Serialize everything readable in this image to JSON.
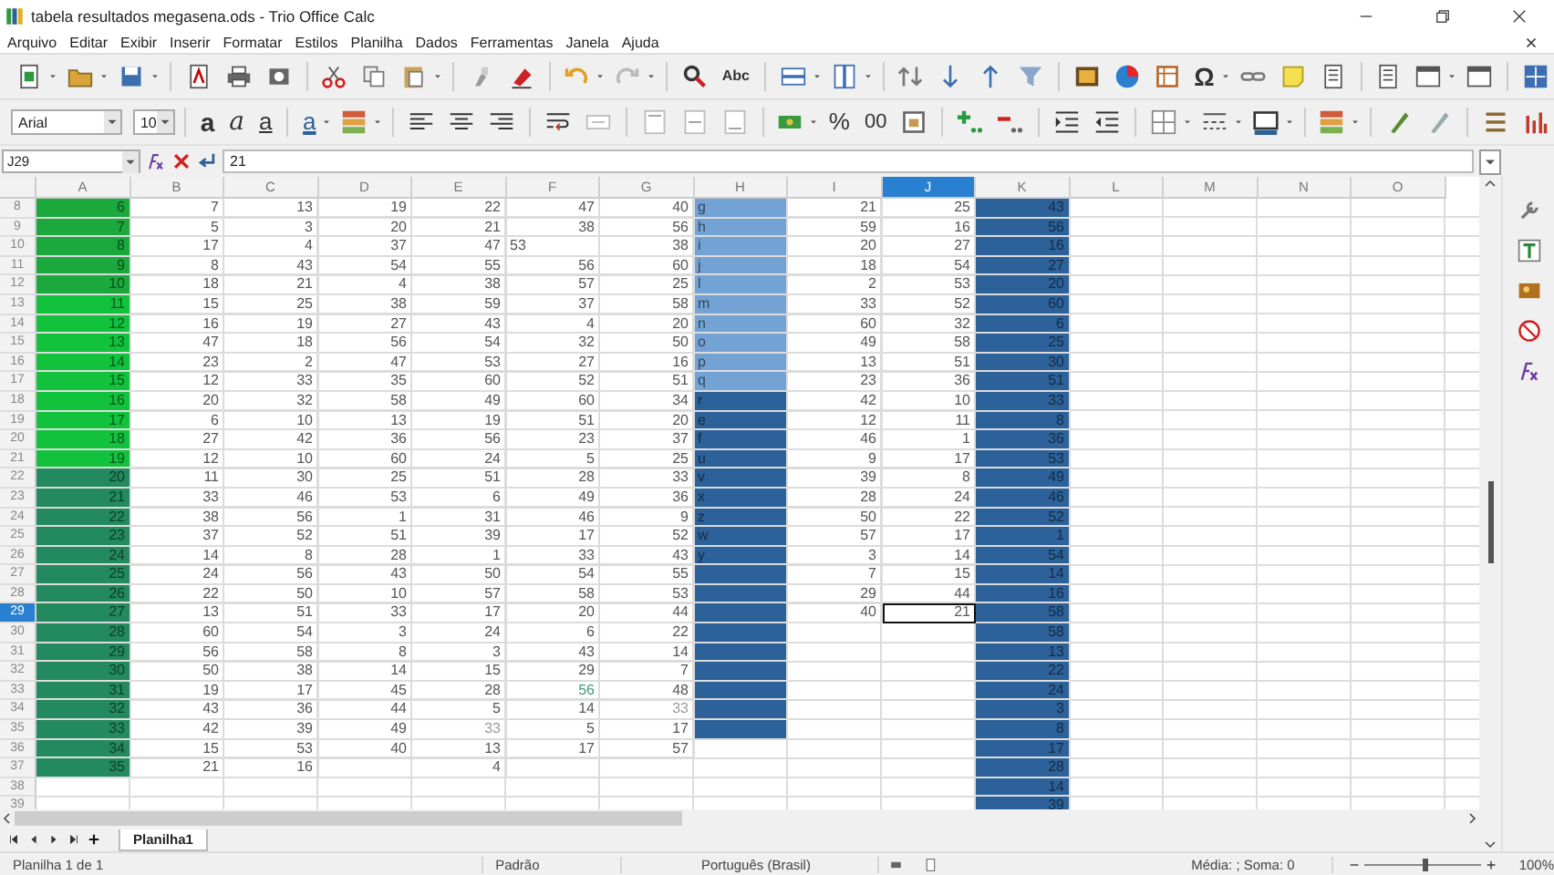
{
  "window": {
    "title": "tabela resultados megasena.ods - Trio Office Calc"
  },
  "menu": [
    "Arquivo",
    "Editar",
    "Exibir",
    "Inserir",
    "Formatar",
    "Estilos",
    "Planilha",
    "Dados",
    "Ferramentas",
    "Janela",
    "Ajuda"
  ],
  "toolbar_glyphs": {
    "spelling": "Abc",
    "special_character": "Ω",
    "bold": "a",
    "italic": "a",
    "underline": "a",
    "font_color": "a",
    "percent": "%",
    "decimal": "00"
  },
  "font": {
    "name": "Arial",
    "size": "10"
  },
  "formula_bar": {
    "cell": "J29",
    "value": "21"
  },
  "columns": [
    {
      "label": "A",
      "selected": false
    },
    {
      "label": "B",
      "selected": false
    },
    {
      "label": "C",
      "selected": false
    },
    {
      "label": "D",
      "selected": false
    },
    {
      "label": "E",
      "selected": false
    },
    {
      "label": "F",
      "selected": false
    },
    {
      "label": "G",
      "selected": false
    },
    {
      "label": "H",
      "selected": false
    },
    {
      "label": "I",
      "selected": false
    },
    {
      "label": "J",
      "selected": true
    },
    {
      "label": "K",
      "selected": false
    },
    {
      "label": "L",
      "selected": false
    },
    {
      "label": "M",
      "selected": false
    },
    {
      "label": "N",
      "selected": false
    },
    {
      "label": "O",
      "selected": false
    }
  ],
  "rows": [
    {
      "number": "8",
      "selected": false,
      "cells": [
        {
          "text": "6",
          "color": "#1ba83c"
        },
        "7",
        "13",
        "19",
        "22",
        "47",
        "40",
        {
          "text": "g",
          "kind": "text",
          "color": "#73a2d4"
        },
        "21",
        "25",
        {
          "text": "43",
          "color": "#2d6199"
        }
      ]
    },
    {
      "number": "9",
      "selected": false,
      "cells": [
        {
          "text": "7",
          "color": "#1ba83c"
        },
        "5",
        "3",
        "20",
        "21",
        "38",
        "56",
        {
          "text": "h",
          "kind": "text",
          "color": "#73a2d4"
        },
        "59",
        "16",
        {
          "text": "56",
          "color": "#2d6199"
        }
      ]
    },
    {
      "number": "10",
      "selected": false,
      "cells": [
        {
          "text": "8",
          "color": "#1ba83c"
        },
        "17",
        "4",
        "37",
        "47",
        {
          "text": "53",
          "kind": "text"
        },
        "38",
        {
          "text": "i",
          "kind": "text",
          "color": "#73a2d4"
        },
        "20",
        "27",
        {
          "text": "16",
          "color": "#2d6199"
        }
      ]
    },
    {
      "number": "11",
      "selected": false,
      "cells": [
        {
          "text": "9",
          "color": "#1ba83c"
        },
        "8",
        "43",
        "54",
        "55",
        "56",
        "60",
        {
          "text": "j",
          "kind": "text",
          "color": "#73a2d4"
        },
        "18",
        "54",
        {
          "text": "27",
          "color": "#2d6199"
        }
      ]
    },
    {
      "number": "12",
      "selected": false,
      "cells": [
        {
          "text": "10",
          "color": "#1ba83c"
        },
        "18",
        "21",
        "4",
        "38",
        "57",
        "25",
        {
          "text": "l",
          "kind": "text",
          "color": "#73a2d4"
        },
        "2",
        "53",
        {
          "text": "20",
          "color": "#2d6199"
        }
      ]
    },
    {
      "number": "13",
      "selected": false,
      "cells": [
        {
          "text": "11",
          "color": "#12c23d"
        },
        "15",
        "25",
        "38",
        "59",
        "37",
        "58",
        {
          "text": "m",
          "kind": "text",
          "color": "#73a2d4"
        },
        "33",
        "52",
        {
          "text": "60",
          "color": "#2d6199"
        }
      ]
    },
    {
      "number": "14",
      "selected": false,
      "cells": [
        {
          "text": "12",
          "color": "#12c23d"
        },
        "16",
        "19",
        "27",
        "43",
        "4",
        "20",
        {
          "text": "n",
          "kind": "text",
          "color": "#73a2d4"
        },
        "60",
        "32",
        {
          "text": "6",
          "color": "#2d6199"
        }
      ]
    },
    {
      "number": "15",
      "selected": false,
      "cells": [
        {
          "text": "13",
          "color": "#12c23d"
        },
        "47",
        "18",
        "56",
        "54",
        "32",
        "50",
        {
          "text": "o",
          "kind": "text",
          "color": "#73a2d4"
        },
        "49",
        "58",
        {
          "text": "25",
          "color": "#2d6199"
        }
      ]
    },
    {
      "number": "16",
      "selected": false,
      "cells": [
        {
          "text": "14",
          "color": "#12c23d"
        },
        "23",
        "2",
        "47",
        "53",
        "27",
        "16",
        {
          "text": "p",
          "kind": "text",
          "color": "#73a2d4"
        },
        "13",
        "51",
        {
          "text": "30",
          "color": "#2d6199"
        }
      ]
    },
    {
      "number": "17",
      "selected": false,
      "cells": [
        {
          "text": "15",
          "color": "#12c23d"
        },
        "12",
        "33",
        "35",
        "60",
        "52",
        "51",
        {
          "text": "q",
          "kind": "text",
          "color": "#73a2d4"
        },
        "23",
        "36",
        {
          "text": "51",
          "color": "#2d6199"
        }
      ]
    },
    {
      "number": "18",
      "selected": false,
      "cells": [
        {
          "text": "16",
          "color": "#12c23d"
        },
        "20",
        "32",
        "58",
        "49",
        "60",
        "34",
        {
          "text": "r",
          "kind": "text",
          "color": "#2d6199"
        },
        "42",
        "10",
        {
          "text": "33",
          "color": "#2d6199"
        }
      ]
    },
    {
      "number": "19",
      "selected": false,
      "cells": [
        {
          "text": "17",
          "color": "#12c23d"
        },
        "6",
        "10",
        "13",
        "19",
        "51",
        "20",
        {
          "text": "e",
          "kind": "text",
          "color": "#2d6199"
        },
        "12",
        "11",
        {
          "text": "8",
          "color": "#2d6199"
        }
      ]
    },
    {
      "number": "20",
      "selected": false,
      "cells": [
        {
          "text": "18",
          "color": "#12c23d"
        },
        "27",
        "42",
        "36",
        "56",
        "23",
        "37",
        {
          "text": "f",
          "kind": "text",
          "color": "#2d6199"
        },
        "46",
        "1",
        {
          "text": "36",
          "color": "#2d6199"
        }
      ]
    },
    {
      "number": "21",
      "selected": false,
      "cells": [
        {
          "text": "19",
          "color": "#12c23d"
        },
        "12",
        "10",
        "60",
        "24",
        "5",
        "25",
        {
          "text": "u",
          "kind": "text",
          "color": "#2d6199"
        },
        "9",
        "17",
        {
          "text": "53",
          "color": "#2d6199"
        }
      ]
    },
    {
      "number": "22",
      "selected": false,
      "cells": [
        {
          "text": "20",
          "color": "#23895e"
        },
        "11",
        "30",
        "25",
        "51",
        "28",
        "33",
        {
          "text": "v",
          "kind": "text",
          "color": "#2d6199"
        },
        "39",
        "8",
        {
          "text": "49",
          "color": "#2d6199"
        }
      ]
    },
    {
      "number": "23",
      "selected": false,
      "cells": [
        {
          "text": "21",
          "color": "#23895e"
        },
        "33",
        "46",
        "53",
        "6",
        "49",
        "36",
        {
          "text": "x",
          "kind": "text",
          "color": "#2d6199"
        },
        "28",
        "24",
        {
          "text": "46",
          "color": "#2d6199"
        }
      ]
    },
    {
      "number": "24",
      "selected": false,
      "cells": [
        {
          "text": "22",
          "color": "#23895e"
        },
        "38",
        "56",
        "1",
        "31",
        "46",
        "9",
        {
          "text": "z",
          "kind": "text",
          "color": "#2d6199"
        },
        "50",
        "22",
        {
          "text": "52",
          "color": "#2d6199"
        }
      ]
    },
    {
      "number": "25",
      "selected": false,
      "cells": [
        {
          "text": "23",
          "color": "#23895e"
        },
        "37",
        "52",
        "51",
        "39",
        "17",
        "52",
        {
          "text": "w",
          "kind": "text",
          "color": "#2d6199"
        },
        "57",
        "17",
        {
          "text": "1",
          "color": "#2d6199"
        }
      ]
    },
    {
      "number": "26",
      "selected": false,
      "cells": [
        {
          "text": "24",
          "color": "#23895e"
        },
        "14",
        "8",
        "28",
        "1",
        "33",
        "43",
        {
          "text": "y",
          "kind": "text",
          "color": "#2d6199"
        },
        "3",
        "14",
        {
          "text": "54",
          "color": "#2d6199"
        }
      ]
    },
    {
      "number": "27",
      "selected": false,
      "cells": [
        {
          "text": "25",
          "color": "#23895e"
        },
        "24",
        "56",
        "43",
        "50",
        "54",
        "55",
        {
          "text": "",
          "color": "#2d6199"
        },
        "7",
        "15",
        {
          "text": "14",
          "color": "#2d6199"
        }
      ]
    },
    {
      "number": "28",
      "selected": false,
      "cells": [
        {
          "text": "26",
          "color": "#23895e"
        },
        "22",
        "50",
        "10",
        "57",
        "58",
        "53",
        {
          "text": "",
          "color": "#2d6199"
        },
        "29",
        "44",
        {
          "text": "16",
          "color": "#2d6199"
        }
      ]
    },
    {
      "number": "29",
      "selected": true,
      "cells": [
        {
          "text": "27",
          "color": "#23895e"
        },
        "13",
        "51",
        "33",
        "17",
        "20",
        "44",
        {
          "text": "",
          "color": "#2d6199"
        },
        "40",
        "21",
        {
          "text": "58",
          "color": "#2d6199"
        }
      ]
    },
    {
      "number": "30",
      "selected": false,
      "cells": [
        {
          "text": "28",
          "color": "#23895e"
        },
        "60",
        "54",
        "3",
        "24",
        "6",
        "22",
        {
          "text": "",
          "color": "#2d6199"
        },
        "",
        "",
        {
          "text": "58",
          "color": "#2d6199"
        }
      ]
    },
    {
      "number": "31",
      "selected": false,
      "cells": [
        {
          "text": "29",
          "color": "#23895e"
        },
        "56",
        "58",
        "8",
        "3",
        "43",
        "14",
        {
          "text": "",
          "color": "#2d6199"
        },
        "",
        "",
        {
          "text": "13",
          "color": "#2d6199"
        }
      ]
    },
    {
      "number": "32",
      "selected": false,
      "cells": [
        {
          "text": "30",
          "color": "#23895e"
        },
        "50",
        "38",
        "14",
        "15",
        "29",
        "7",
        {
          "text": "",
          "color": "#2d6199"
        },
        "",
        "",
        {
          "text": "22",
          "color": "#2d6199"
        }
      ]
    },
    {
      "number": "33",
      "selected": false,
      "cells": [
        {
          "text": "31",
          "color": "#23895e"
        },
        "19",
        "17",
        "45",
        "28",
        {
          "text": "56",
          "kind": "highlighted"
        },
        "48",
        {
          "text": "",
          "color": "#2d6199"
        },
        "",
        "",
        {
          "text": "24",
          "color": "#2d6199"
        }
      ]
    },
    {
      "number": "34",
      "selected": false,
      "cells": [
        {
          "text": "32",
          "color": "#23895e"
        },
        "43",
        "36",
        "44",
        "5",
        "14",
        {
          "text": "33",
          "kind": "faded"
        },
        {
          "text": "",
          "color": "#2d6199"
        },
        "",
        "",
        {
          "text": "3",
          "color": "#2d6199"
        }
      ]
    },
    {
      "number": "35",
      "selected": false,
      "cells": [
        {
          "text": "33",
          "color": "#23895e"
        },
        "42",
        "39",
        "49",
        {
          "text": "33",
          "kind": "faded"
        },
        "5",
        "17",
        {
          "text": "",
          "color": "#2d6199"
        },
        "",
        "",
        {
          "text": "8",
          "color": "#2d6199"
        }
      ]
    },
    {
      "number": "36",
      "selected": false,
      "cells": [
        {
          "text": "34",
          "color": "#23895e"
        },
        "15",
        "53",
        "40",
        "13",
        "17",
        "57",
        "",
        "",
        "",
        {
          "text": "17",
          "color": "#2d6199"
        }
      ]
    },
    {
      "number": "37",
      "selected": false,
      "cells": [
        {
          "text": "35",
          "color": "#23895e"
        },
        "21",
        "16",
        "",
        "4",
        "",
        "",
        "",
        "",
        "",
        {
          "text": "28",
          "color": "#2d6199"
        }
      ]
    },
    {
      "number": "38",
      "selected": false,
      "cells": [
        "",
        "",
        "",
        "",
        "",
        "",
        "",
        "",
        "",
        "",
        {
          "text": "14",
          "color": "#2d6199"
        }
      ]
    },
    {
      "number": "39",
      "selected": false,
      "cells": [
        "",
        "",
        "",
        "",
        "",
        "",
        "",
        "",
        "",
        "",
        {
          "text": "39",
          "color": "#2d6199"
        }
      ]
    }
  ],
  "sheet_tabs": [
    {
      "label": "Planilha1",
      "selected": true
    }
  ],
  "status_bar": {
    "sheet": "Planilha 1 de 1",
    "style": "Padrão",
    "language": "Português (Brasil)",
    "summary": "Média: ; Soma: 0",
    "zoom": "100%",
    "zoom_slider": {
      "level": 0.5
    }
  }
}
